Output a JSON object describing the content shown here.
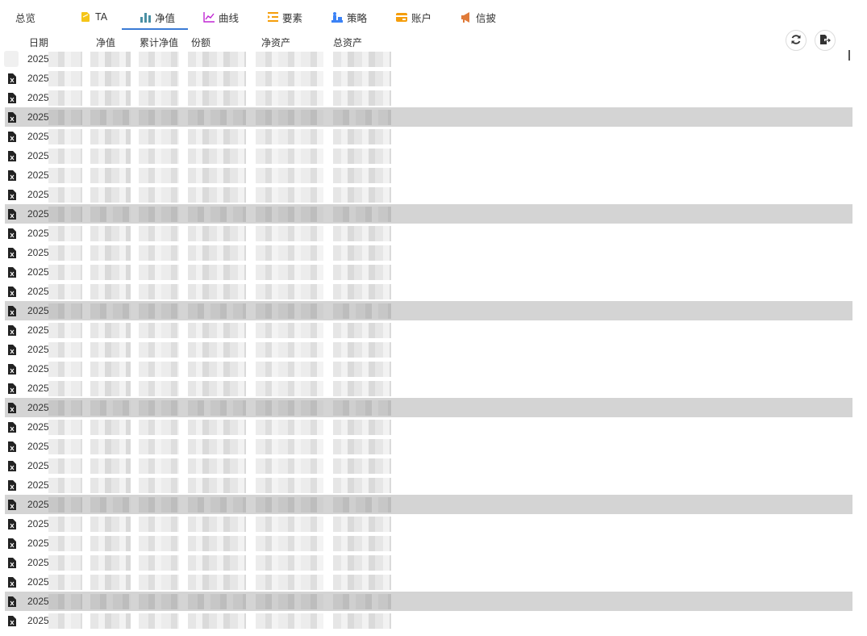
{
  "tabs": [
    {
      "label": "总览",
      "icon": "none"
    },
    {
      "label": "TA",
      "icon": "tag-icon",
      "color": "#f5c518"
    },
    {
      "label": "净值",
      "icon": "bar-chart-icon",
      "color": "#4a90a4"
    },
    {
      "label": "曲线",
      "icon": "line-chart-icon",
      "color": "#c026d3"
    },
    {
      "label": "要素",
      "icon": "list-indent-icon",
      "color": "#f59e0b"
    },
    {
      "label": "策略",
      "icon": "chess-icon",
      "color": "#3b82f6"
    },
    {
      "label": "账户",
      "icon": "card-icon",
      "color": "#f59e0b"
    },
    {
      "label": "信披",
      "icon": "megaphone-icon",
      "color": "#e07b39"
    }
  ],
  "active_tab": "净值",
  "table": {
    "columns": [
      "日期",
      "净值",
      "累计净值",
      "份额",
      "净资产",
      "总资产"
    ],
    "row_date_prefix": "2025",
    "row_count": 30,
    "highlight_rows": [
      3,
      8,
      13,
      18,
      23,
      28
    ]
  },
  "actions": {
    "refresh_icon": "refresh-icon",
    "export_icon": "export-icon"
  }
}
